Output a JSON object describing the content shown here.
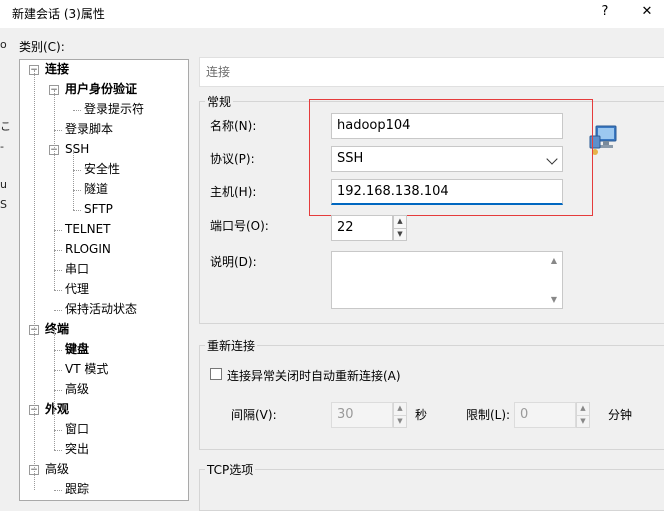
{
  "window": {
    "title": "新建会话 (3)属性",
    "help_label": "?",
    "close_label": "✕"
  },
  "edge_glyphs": [
    "o",
    "こ",
    "-",
    "u",
    "S"
  ],
  "category_label": "类别(C):",
  "tree": [
    {
      "label": "连接",
      "bold": true,
      "level": 0,
      "expander": "⊟"
    },
    {
      "label": "用户身份验证",
      "bold": true,
      "level": 1,
      "expander": "⊟"
    },
    {
      "label": "登录提示符",
      "bold": false,
      "level": 2
    },
    {
      "label": "登录脚本",
      "bold": false,
      "level": 1
    },
    {
      "label": "SSH",
      "bold": false,
      "level": 1,
      "expander": "⊟"
    },
    {
      "label": "安全性",
      "bold": false,
      "level": 2
    },
    {
      "label": "隧道",
      "bold": false,
      "level": 2
    },
    {
      "label": "SFTP",
      "bold": false,
      "level": 2
    },
    {
      "label": "TELNET",
      "bold": false,
      "level": 1
    },
    {
      "label": "RLOGIN",
      "bold": false,
      "level": 1
    },
    {
      "label": "串口",
      "bold": false,
      "level": 1
    },
    {
      "label": "代理",
      "bold": false,
      "level": 1
    },
    {
      "label": "保持活动状态",
      "bold": false,
      "level": 1
    },
    {
      "label": "终端",
      "bold": true,
      "level": 0,
      "expander": "⊟"
    },
    {
      "label": "键盘",
      "bold": true,
      "level": 1
    },
    {
      "label": "VT 模式",
      "bold": false,
      "level": 1
    },
    {
      "label": "高级",
      "bold": false,
      "level": 1
    },
    {
      "label": "外观",
      "bold": true,
      "level": 0,
      "expander": "⊟"
    },
    {
      "label": "窗口",
      "bold": false,
      "level": 1
    },
    {
      "label": "突出",
      "bold": false,
      "level": 1
    },
    {
      "label": "高级",
      "bold": false,
      "level": 0,
      "expander": "⊟"
    },
    {
      "label": "跟踪",
      "bold": false,
      "level": 1
    }
  ],
  "panel": {
    "header": "连接",
    "general": {
      "title": "常规",
      "name_label": "名称(N):",
      "name_value": "hadoop104",
      "protocol_label": "协议(P):",
      "protocol_value": "SSH",
      "host_label": "主机(H):",
      "host_value": "192.168.138.104",
      "port_label": "端口号(O):",
      "port_value": "22",
      "desc_label": "说明(D):",
      "desc_value": ""
    },
    "reconnect": {
      "title": "重新连接",
      "checkbox_label": "连接异常关闭时自动重新连接(A)",
      "checked": false,
      "interval_label": "间隔(V):",
      "interval_value": "30",
      "interval_unit": "秒",
      "limit_label": "限制(L):",
      "limit_value": "0",
      "limit_unit": "分钟"
    },
    "tcp": {
      "title": "TCP选项"
    }
  },
  "icons": {
    "computer": "network-computer-icon"
  },
  "colors": {
    "highlight_border": "#e53c3c",
    "host_underline": "#0067c0"
  }
}
